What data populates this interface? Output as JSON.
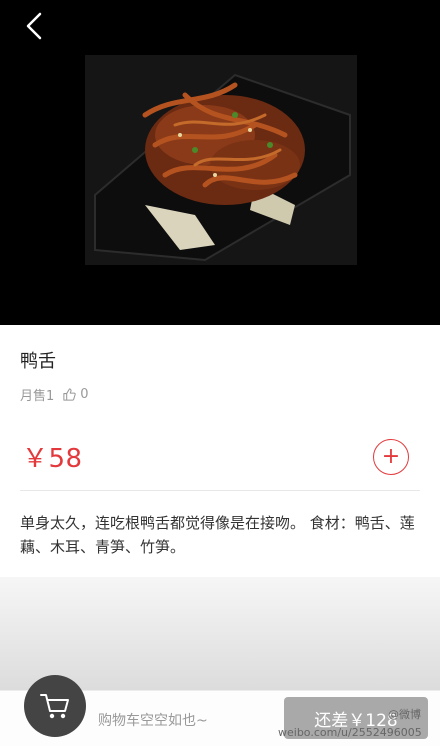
{
  "dish": {
    "name": "鸭舌",
    "monthly_sales": "月售1",
    "likes": "0",
    "price": "￥58",
    "add_label": "+",
    "description": "单身太久，连吃根鸭舌都觉得像是在接吻。 食材：鸭舌、莲藕、木耳、青笋、竹笋。"
  },
  "cart": {
    "empty_text": "购物车空空如也~",
    "min_diff_label": "还差￥128"
  },
  "watermark": {
    "handle": "@微博",
    "url": "weibo.com/u/2552496005"
  },
  "colors": {
    "accent": "#e4393c",
    "hero_bg": "#000000",
    "cart_icon_bg": "#444444",
    "button_disabled": "#a9a9a9"
  },
  "icons": {
    "back": "chevron-left-icon",
    "like": "thumbs-up-icon",
    "cart": "shopping-cart-icon"
  }
}
